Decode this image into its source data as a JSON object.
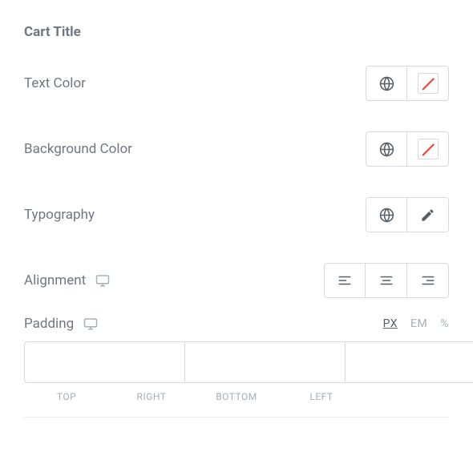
{
  "section_title": "Cart Title",
  "text_color": {
    "label": "Text Color"
  },
  "background_color": {
    "label": "Background Color"
  },
  "typography": {
    "label": "Typography"
  },
  "alignment": {
    "label": "Alignment"
  },
  "padding": {
    "label": "Padding",
    "units": {
      "px": "PX",
      "em": "EM",
      "pct": "%"
    },
    "active_unit": "px",
    "values": {
      "top": "",
      "right": "",
      "bottom": "",
      "left": ""
    },
    "side_labels": {
      "top": "TOP",
      "right": "RIGHT",
      "bottom": "BOTTOM",
      "left": "LEFT"
    }
  }
}
